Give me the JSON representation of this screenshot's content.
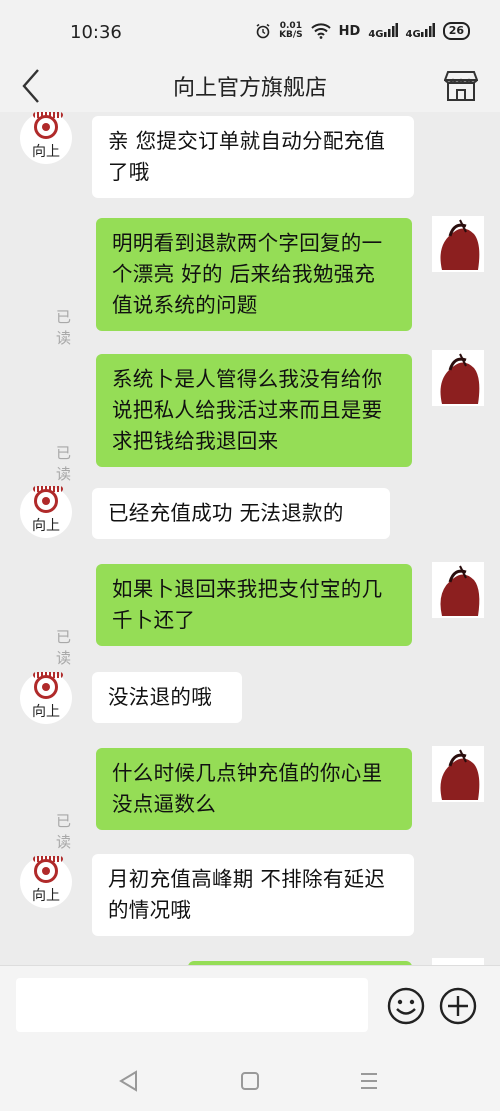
{
  "status_bar": {
    "time": "10:36",
    "net_speed_value": "0.01",
    "net_speed_unit": "KB/S",
    "hd_label": "HD",
    "signal1_label": "4G",
    "signal2_label": "4G",
    "battery": "26"
  },
  "header": {
    "title": "向上官方旗舰店",
    "back_icon": "chevron-left-icon",
    "store_icon": "store-icon"
  },
  "chat": {
    "shop_avatar_label": "向上",
    "read_label": "已读",
    "messages": [
      {
        "from": "shop",
        "text": "亲 您提交订单就自动分配充值了哦"
      },
      {
        "from": "me",
        "text": "明明看到退款两个字回复的一个漂亮  好的  后来给我勉强充值说系统的问题",
        "status": "已读"
      },
      {
        "from": "me",
        "text": "系统卜是人管得么我没有给你说把私人给我活过来而且是要求把钱给我退回来",
        "status": "已读"
      },
      {
        "from": "shop",
        "text": "已经充值成功 无法退款的"
      },
      {
        "from": "me",
        "text": "如果卜退回来我把支付宝的几千卜还了",
        "status": "已读"
      },
      {
        "from": "shop",
        "text": "没法退的哦"
      },
      {
        "from": "me",
        "text": "什么时候几点钟充值的你心里没点逼数么",
        "status": "已读"
      },
      {
        "from": "shop",
        "text": "月初充值高峰期 不排除有延迟的情况哦"
      }
    ]
  },
  "input_bar": {
    "placeholder": "",
    "emoji_icon": "emoji-icon",
    "plus_icon": "plus-icon"
  },
  "nav_bar": {
    "back": "back-triangle-icon",
    "home": "home-square-icon",
    "menu": "menu-lines-icon"
  }
}
